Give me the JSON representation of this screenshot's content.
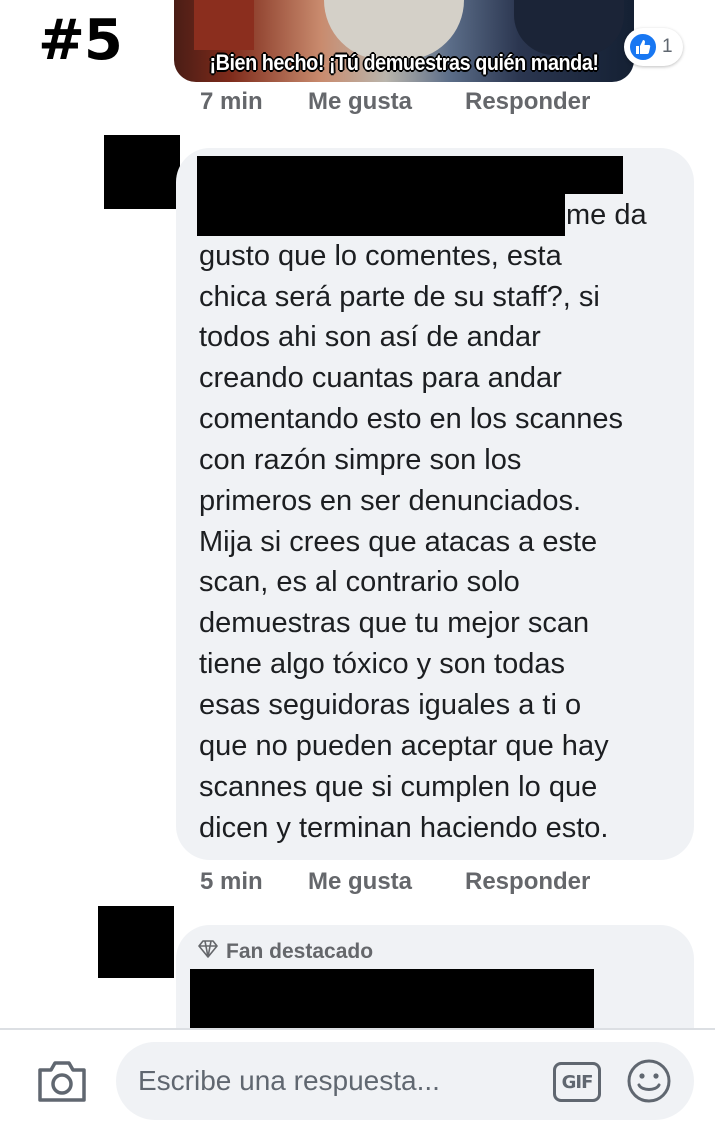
{
  "overlay": {
    "number_tag": "#5"
  },
  "gif": {
    "caption": "¡Bien hecho! ¡Tú demuestras quién manda!"
  },
  "first_comment": {
    "reaction_icon": "like-icon",
    "reaction_count": "1",
    "time": "7 min",
    "like_label": "Me gusta",
    "reply_label": "Responder"
  },
  "main_comment": {
    "lines": [
      "me da",
      "gusto que lo comentes, esta",
      "chica será parte de su staff?, si",
      "todos ahi son así de andar",
      "creando cuantas para andar",
      "comentando esto en los scannes",
      "con razón simpre son los",
      "primeros en ser denunciados.",
      "Mija si crees que atacas a este",
      "scan, es al contrario solo",
      "demuestras que tu mejor scan",
      "tiene algo tóxico y son todas",
      "esas seguidoras iguales a ti o",
      "que no pueden aceptar que hay",
      "scannes que si cumplen lo que",
      "dicen y terminan haciendo esto."
    ],
    "time": "5 min",
    "like_label": "Me gusta",
    "reply_label": "Responder"
  },
  "next_comment": {
    "badge_icon": "diamond-icon",
    "badge_label": "Fan destacado"
  },
  "composer": {
    "camera_icon": "camera-icon",
    "placeholder": "Escribe una respuesta...",
    "gif_label": "GIF",
    "emoji_icon": "smiley-icon"
  },
  "colors": {
    "like_blue": "#1877f2",
    "bubble_bg": "#f0f2f5",
    "meta_gray": "#65676b"
  }
}
